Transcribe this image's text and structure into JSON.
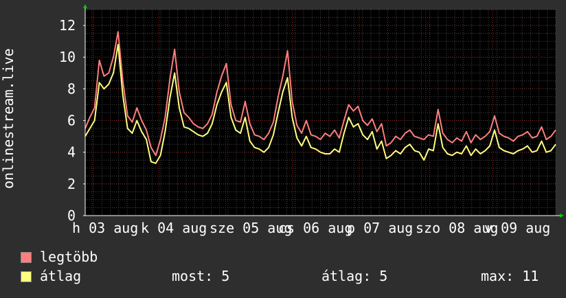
{
  "chart_data": {
    "type": "line",
    "ylabel": "onlinestream.live",
    "ylim": [
      0,
      13
    ],
    "y_ticks": [
      "0",
      "2",
      "4",
      "6",
      "8",
      "10",
      "12"
    ],
    "x_tick_labels": [
      "h 03 aug",
      "k 04 aug",
      "sze 05 aug",
      "cs 06 aug",
      "p 07 aug",
      "szo 08 aug",
      "v 09 aug"
    ],
    "grid": true,
    "colors": {
      "background": "#2e2e2e",
      "plot_background": "#000000",
      "grid_major": "#8b2b2b",
      "grid_minor": "#4a4a4a",
      "axis": "#ffffff",
      "arrow": "#00cc00",
      "max_series": "#ff7f7f",
      "avg_series": "#ffff7f"
    },
    "series": [
      {
        "name": "legtöbb",
        "color": "#ff7f7f",
        "values": [
          5.5,
          6.2,
          6.8,
          9.8,
          8.8,
          9.0,
          10.0,
          11.6,
          8.5,
          6.3,
          5.9,
          6.8,
          6.0,
          5.4,
          4.3,
          3.8,
          4.8,
          6.2,
          8.6,
          10.5,
          7.8,
          6.5,
          6.2,
          5.8,
          5.6,
          5.5,
          5.8,
          6.4,
          7.8,
          8.8,
          9.6,
          7.0,
          6.0,
          5.9,
          7.2,
          5.8,
          5.1,
          5.0,
          4.8,
          5.2,
          5.9,
          7.5,
          8.8,
          10.4,
          7.2,
          5.7,
          5.2,
          6.0,
          5.1,
          5.0,
          4.8,
          5.2,
          5.0,
          5.4,
          4.9,
          6.0,
          7.0,
          6.6,
          6.9,
          6.0,
          5.7,
          6.1,
          5.3,
          5.8,
          4.4,
          4.6,
          5.0,
          4.8,
          5.2,
          5.4,
          5.0,
          4.9,
          4.8,
          5.1,
          5.0,
          6.7,
          5.2,
          4.8,
          4.6,
          4.9,
          4.7,
          5.3,
          4.6,
          5.1,
          4.8,
          5.0,
          5.3,
          6.3,
          5.2,
          5.0,
          4.9,
          4.7,
          5.0,
          5.1,
          5.3,
          4.9,
          5.0,
          5.6,
          4.8,
          5.0,
          5.4
        ]
      },
      {
        "name": "átlag",
        "color": "#ffff7f",
        "values": [
          5.0,
          5.5,
          6.0,
          8.4,
          8.0,
          8.3,
          9.0,
          10.8,
          7.6,
          5.5,
          5.2,
          6.0,
          5.3,
          4.8,
          3.4,
          3.3,
          3.8,
          5.3,
          7.4,
          9.0,
          6.8,
          5.6,
          5.5,
          5.3,
          5.1,
          5.0,
          5.2,
          5.8,
          7.0,
          7.8,
          8.4,
          6.2,
          5.4,
          5.2,
          6.2,
          4.7,
          4.3,
          4.2,
          4.0,
          4.3,
          5.1,
          6.5,
          7.8,
          8.7,
          6.2,
          4.9,
          4.4,
          5.0,
          4.3,
          4.2,
          4.0,
          3.9,
          3.9,
          4.2,
          4.0,
          5.2,
          6.2,
          5.6,
          5.8,
          5.1,
          4.8,
          5.3,
          4.2,
          4.7,
          3.6,
          3.8,
          4.1,
          3.9,
          4.3,
          4.5,
          4.1,
          4.0,
          3.5,
          4.2,
          4.1,
          5.8,
          4.3,
          3.9,
          3.8,
          4.0,
          3.9,
          4.4,
          3.8,
          4.2,
          3.9,
          4.1,
          4.4,
          5.4,
          4.3,
          4.1,
          4.0,
          3.9,
          4.1,
          4.2,
          4.4,
          4.0,
          4.1,
          4.7,
          4.0,
          4.1,
          4.5
        ]
      }
    ]
  },
  "legend": {
    "max_label": "legtöbb",
    "avg_label": "átlag"
  },
  "stats": {
    "now_label": "most: 5",
    "avg_label": "átlag: 5",
    "max_label": "max: 11"
  }
}
